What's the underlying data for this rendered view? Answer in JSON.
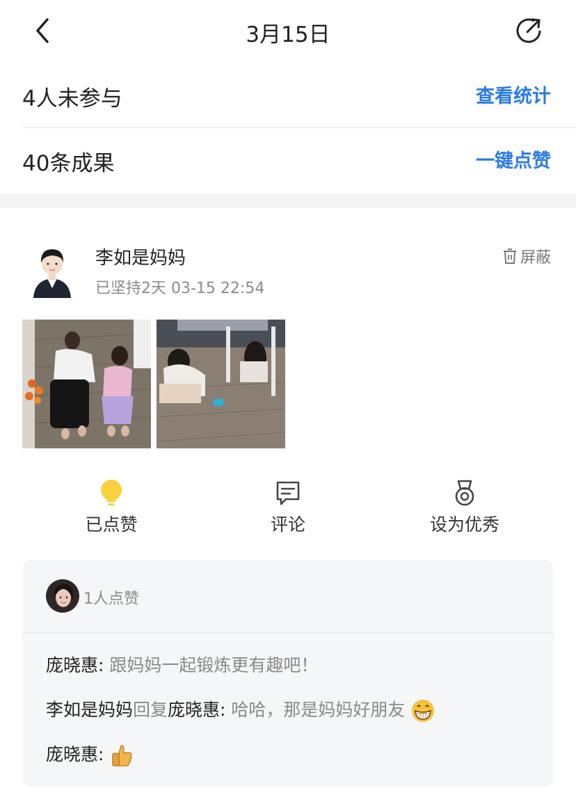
{
  "nav": {
    "title": "3月15日",
    "back_icon": "chevron-left-icon",
    "share_icon": "share-icon"
  },
  "stats": {
    "not_joined": "4人未参与",
    "view_stats": "查看统计",
    "results": "40条成果",
    "like_all": "一键点赞"
  },
  "post": {
    "author": "李如是妈妈",
    "meta": "已坚持2天 03-15 22:54",
    "mute_label": "屏蔽",
    "actions": {
      "liked": "已点赞",
      "comment": "评论",
      "set_excellent": "设为优秀"
    },
    "like_count": "1人点赞",
    "comments": [
      {
        "author": "庞晓惠",
        "sep": ": ",
        "text": "跟妈妈一起锻炼更有趣吧！"
      },
      {
        "author": "李如是妈妈",
        "reply": "回复",
        "target": "庞晓惠",
        "sep": ": ",
        "text": "哈哈，那是妈妈好朋友"
      },
      {
        "author": "庞晓惠",
        "sep": ": "
      }
    ]
  },
  "colors": {
    "accent": "#2a7be4",
    "like_bulb": "#f7d23c",
    "muted": "#8a8a8a"
  }
}
